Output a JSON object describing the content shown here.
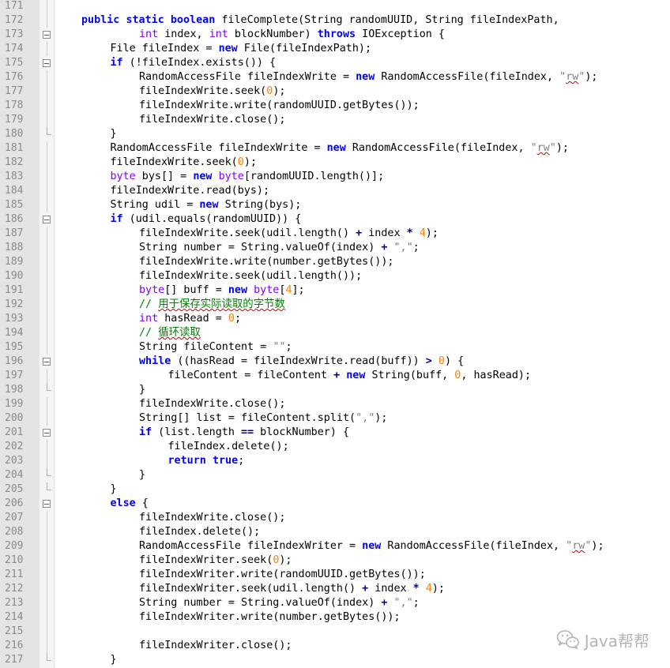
{
  "editor": {
    "lines": [
      {
        "n": "171",
        "indent": 0,
        "fold": "line",
        "tokens": []
      },
      {
        "n": "172",
        "indent": 1,
        "fold": "line",
        "tokens": [
          [
            "kw",
            "public"
          ],
          [
            "t",
            " "
          ],
          [
            "kw",
            "static"
          ],
          [
            "t",
            " "
          ],
          [
            "kw",
            "boolean"
          ],
          [
            "t",
            " fileComplete(String randomUUID, String fileIndexPath,"
          ]
        ]
      },
      {
        "n": "173",
        "indent": 3,
        "fold": "box",
        "tokens": [
          [
            "ty",
            "int"
          ],
          [
            "t",
            " index, "
          ],
          [
            "ty",
            "int"
          ],
          [
            "t",
            " blockNumber) "
          ],
          [
            "kw",
            "throws"
          ],
          [
            "t",
            " IOException {"
          ]
        ]
      },
      {
        "n": "174",
        "indent": 2,
        "fold": "line",
        "tokens": [
          [
            "t",
            "File fileIndex = "
          ],
          [
            "kw",
            "new"
          ],
          [
            "t",
            " File(fileIndexPath);"
          ]
        ]
      },
      {
        "n": "175",
        "indent": 2,
        "fold": "box",
        "tokens": [
          [
            "kw",
            "if"
          ],
          [
            "t",
            " (!fileIndex.exists()) {"
          ]
        ]
      },
      {
        "n": "176",
        "indent": 3,
        "fold": "line",
        "tokens": [
          [
            "t",
            "RandomAccessFile fileIndexWrite = "
          ],
          [
            "kw",
            "new"
          ],
          [
            "t",
            " RandomAccessFile(fileIndex, "
          ],
          [
            "str",
            "\""
          ],
          [
            "wavy",
            "rw"
          ],
          [
            "str",
            "\""
          ],
          [
            "t",
            ");"
          ]
        ]
      },
      {
        "n": "177",
        "indent": 3,
        "fold": "line",
        "tokens": [
          [
            "t",
            "fileIndexWrite.seek("
          ],
          [
            "num",
            "0"
          ],
          [
            "t",
            ");"
          ]
        ]
      },
      {
        "n": "178",
        "indent": 3,
        "fold": "line",
        "tokens": [
          [
            "t",
            "fileIndexWrite.write(randomUUID.getBytes());"
          ]
        ]
      },
      {
        "n": "179",
        "indent": 3,
        "fold": "line",
        "tokens": [
          [
            "t",
            "fileIndexWrite.close();"
          ]
        ]
      },
      {
        "n": "180",
        "indent": 2,
        "fold": "end",
        "tokens": [
          [
            "t",
            "}"
          ]
        ]
      },
      {
        "n": "181",
        "indent": 2,
        "fold": "line",
        "tokens": [
          [
            "t",
            "RandomAccessFile fileIndexWrite = "
          ],
          [
            "kw",
            "new"
          ],
          [
            "t",
            " RandomAccessFile(fileIndex, "
          ],
          [
            "str",
            "\""
          ],
          [
            "wavy",
            "rw"
          ],
          [
            "str",
            "\""
          ],
          [
            "t",
            ");"
          ]
        ]
      },
      {
        "n": "182",
        "indent": 2,
        "fold": "line",
        "tokens": [
          [
            "t",
            "fileIndexWrite.seek("
          ],
          [
            "num",
            "0"
          ],
          [
            "t",
            ");"
          ]
        ]
      },
      {
        "n": "183",
        "indent": 2,
        "fold": "line",
        "tokens": [
          [
            "ty",
            "byte"
          ],
          [
            "t",
            " bys[] = "
          ],
          [
            "kw",
            "new"
          ],
          [
            "t",
            " "
          ],
          [
            "ty",
            "byte"
          ],
          [
            "t",
            "[randomUUID.length()];"
          ]
        ]
      },
      {
        "n": "184",
        "indent": 2,
        "fold": "line",
        "tokens": [
          [
            "t",
            "fileIndexWrite.read(bys);"
          ]
        ]
      },
      {
        "n": "185",
        "indent": 2,
        "fold": "line",
        "tokens": [
          [
            "t",
            "String udil = "
          ],
          [
            "kw",
            "new"
          ],
          [
            "t",
            " String(bys);"
          ]
        ]
      },
      {
        "n": "186",
        "indent": 2,
        "fold": "box",
        "tokens": [
          [
            "kw",
            "if"
          ],
          [
            "t",
            " (udil.equals(randomUUID)) {"
          ]
        ]
      },
      {
        "n": "187",
        "indent": 3,
        "fold": "line",
        "tokens": [
          [
            "t",
            "fileIndexWrite.seek(udil.length() "
          ],
          [
            "op",
            "+"
          ],
          [
            "t",
            " index "
          ],
          [
            "op",
            "*"
          ],
          [
            "t",
            " "
          ],
          [
            "num",
            "4"
          ],
          [
            "t",
            ");"
          ]
        ]
      },
      {
        "n": "188",
        "indent": 3,
        "fold": "line",
        "tokens": [
          [
            "t",
            "String number = String.valueOf(index) "
          ],
          [
            "op",
            "+"
          ],
          [
            "t",
            " "
          ],
          [
            "str",
            "\",\""
          ],
          [
            "t",
            ";"
          ]
        ]
      },
      {
        "n": "189",
        "indent": 3,
        "fold": "line",
        "tokens": [
          [
            "t",
            "fileIndexWrite.write(number.getBytes());"
          ]
        ]
      },
      {
        "n": "190",
        "indent": 3,
        "fold": "line",
        "tokens": [
          [
            "t",
            "fileIndexWrite.seek(udil.length());"
          ]
        ]
      },
      {
        "n": "191",
        "indent": 3,
        "fold": "line",
        "tokens": [
          [
            "ty",
            "byte"
          ],
          [
            "t",
            "[] buff = "
          ],
          [
            "kw",
            "new"
          ],
          [
            "t",
            " "
          ],
          [
            "ty",
            "byte"
          ],
          [
            "t",
            "["
          ],
          [
            "num",
            "4"
          ],
          [
            "t",
            "];"
          ]
        ]
      },
      {
        "n": "192",
        "indent": 3,
        "fold": "line",
        "tokens": [
          [
            "cmt",
            "// "
          ],
          [
            "cmtw",
            "用于保存实际读取的字节数"
          ]
        ]
      },
      {
        "n": "193",
        "indent": 3,
        "fold": "line",
        "tokens": [
          [
            "ty",
            "int"
          ],
          [
            "t",
            " hasRead = "
          ],
          [
            "num",
            "0"
          ],
          [
            "t",
            ";"
          ]
        ]
      },
      {
        "n": "194",
        "indent": 3,
        "fold": "line",
        "tokens": [
          [
            "cmt",
            "// "
          ],
          [
            "cmtw",
            "循环读取"
          ]
        ]
      },
      {
        "n": "195",
        "indent": 3,
        "fold": "line",
        "tokens": [
          [
            "t",
            "String fileContent = "
          ],
          [
            "str",
            "\"\""
          ],
          [
            "t",
            ";"
          ]
        ]
      },
      {
        "n": "196",
        "indent": 3,
        "fold": "box",
        "tokens": [
          [
            "kw",
            "while"
          ],
          [
            "t",
            " ((hasRead = fileIndexWrite.read(buff)) "
          ],
          [
            "op",
            ">"
          ],
          [
            "t",
            " "
          ],
          [
            "num",
            "0"
          ],
          [
            "t",
            ") {"
          ]
        ]
      },
      {
        "n": "197",
        "indent": 4,
        "fold": "line",
        "tokens": [
          [
            "t",
            "fileContent = fileContent "
          ],
          [
            "op",
            "+"
          ],
          [
            "t",
            " "
          ],
          [
            "kw",
            "new"
          ],
          [
            "t",
            " String(buff, "
          ],
          [
            "num",
            "0"
          ],
          [
            "t",
            ", hasRead);"
          ]
        ]
      },
      {
        "n": "198",
        "indent": 3,
        "fold": "end",
        "tokens": [
          [
            "t",
            "}"
          ]
        ]
      },
      {
        "n": "199",
        "indent": 3,
        "fold": "line",
        "tokens": [
          [
            "t",
            "fileIndexWrite.close();"
          ]
        ]
      },
      {
        "n": "200",
        "indent": 3,
        "fold": "line",
        "tokens": [
          [
            "t",
            "String[] list = fileContent.split("
          ],
          [
            "str",
            "\",\""
          ],
          [
            "t",
            ");"
          ]
        ]
      },
      {
        "n": "201",
        "indent": 3,
        "fold": "box",
        "tokens": [
          [
            "kw",
            "if"
          ],
          [
            "t",
            " (list.length "
          ],
          [
            "op",
            "=="
          ],
          [
            "t",
            " blockNumber) {"
          ]
        ]
      },
      {
        "n": "202",
        "indent": 4,
        "fold": "line",
        "tokens": [
          [
            "t",
            "fileIndex.delete();"
          ]
        ]
      },
      {
        "n": "203",
        "indent": 4,
        "fold": "line",
        "tokens": [
          [
            "kw",
            "return"
          ],
          [
            "t",
            " "
          ],
          [
            "kw",
            "true"
          ],
          [
            "t",
            ";"
          ]
        ]
      },
      {
        "n": "204",
        "indent": 3,
        "fold": "end",
        "tokens": [
          [
            "t",
            "}"
          ]
        ]
      },
      {
        "n": "205",
        "indent": 2,
        "fold": "end",
        "tokens": [
          [
            "t",
            "}"
          ]
        ]
      },
      {
        "n": "206",
        "indent": 2,
        "fold": "box",
        "tokens": [
          [
            "kw",
            "else"
          ],
          [
            "t",
            " {"
          ]
        ]
      },
      {
        "n": "207",
        "indent": 3,
        "fold": "line",
        "tokens": [
          [
            "t",
            "fileIndexWrite.close();"
          ]
        ]
      },
      {
        "n": "208",
        "indent": 3,
        "fold": "line",
        "tokens": [
          [
            "t",
            "fileIndex.delete();"
          ]
        ]
      },
      {
        "n": "209",
        "indent": 3,
        "fold": "line",
        "tokens": [
          [
            "t",
            "RandomAccessFile fileIndexWriter = "
          ],
          [
            "kw",
            "new"
          ],
          [
            "t",
            " RandomAccessFile(fileIndex, "
          ],
          [
            "str",
            "\""
          ],
          [
            "wavy",
            "rw"
          ],
          [
            "str",
            "\""
          ],
          [
            "t",
            ");"
          ]
        ]
      },
      {
        "n": "210",
        "indent": 3,
        "fold": "line",
        "tokens": [
          [
            "t",
            "fileIndexWriter.seek("
          ],
          [
            "num",
            "0"
          ],
          [
            "t",
            ");"
          ]
        ]
      },
      {
        "n": "211",
        "indent": 3,
        "fold": "line",
        "tokens": [
          [
            "t",
            "fileIndexWriter.write(randomUUID.getBytes());"
          ]
        ]
      },
      {
        "n": "212",
        "indent": 3,
        "fold": "line",
        "tokens": [
          [
            "t",
            "fileIndexWriter.seek(udil.length() "
          ],
          [
            "op",
            "+"
          ],
          [
            "t",
            " index "
          ],
          [
            "op",
            "*"
          ],
          [
            "t",
            " "
          ],
          [
            "num",
            "4"
          ],
          [
            "t",
            ");"
          ]
        ]
      },
      {
        "n": "213",
        "indent": 3,
        "fold": "line",
        "tokens": [
          [
            "t",
            "String number = String.valueOf(index) "
          ],
          [
            "op",
            "+"
          ],
          [
            "t",
            " "
          ],
          [
            "str",
            "\",\""
          ],
          [
            "t",
            ";"
          ]
        ]
      },
      {
        "n": "214",
        "indent": 3,
        "fold": "line",
        "tokens": [
          [
            "t",
            "fileIndexWriter.write(number.getBytes());"
          ]
        ]
      },
      {
        "n": "215",
        "indent": 0,
        "fold": "line",
        "tokens": []
      },
      {
        "n": "216",
        "indent": 3,
        "fold": "line",
        "tokens": [
          [
            "t",
            "fileIndexWriter.close();"
          ]
        ]
      },
      {
        "n": "217",
        "indent": 2,
        "fold": "end",
        "tokens": [
          [
            "t",
            "}"
          ]
        ]
      }
    ]
  },
  "watermark": {
    "text": "Java帮帮",
    "icon": "wechat-icon",
    "color": "#b5b5b5"
  },
  "colors": {
    "keyword": "#0000ff",
    "type": "#8000ff",
    "number": "#ff8000",
    "operator": "#000080",
    "string": "#808080",
    "comment": "#008000",
    "gutter": "#e4e4e4",
    "line_number": "#8a8a8a"
  }
}
